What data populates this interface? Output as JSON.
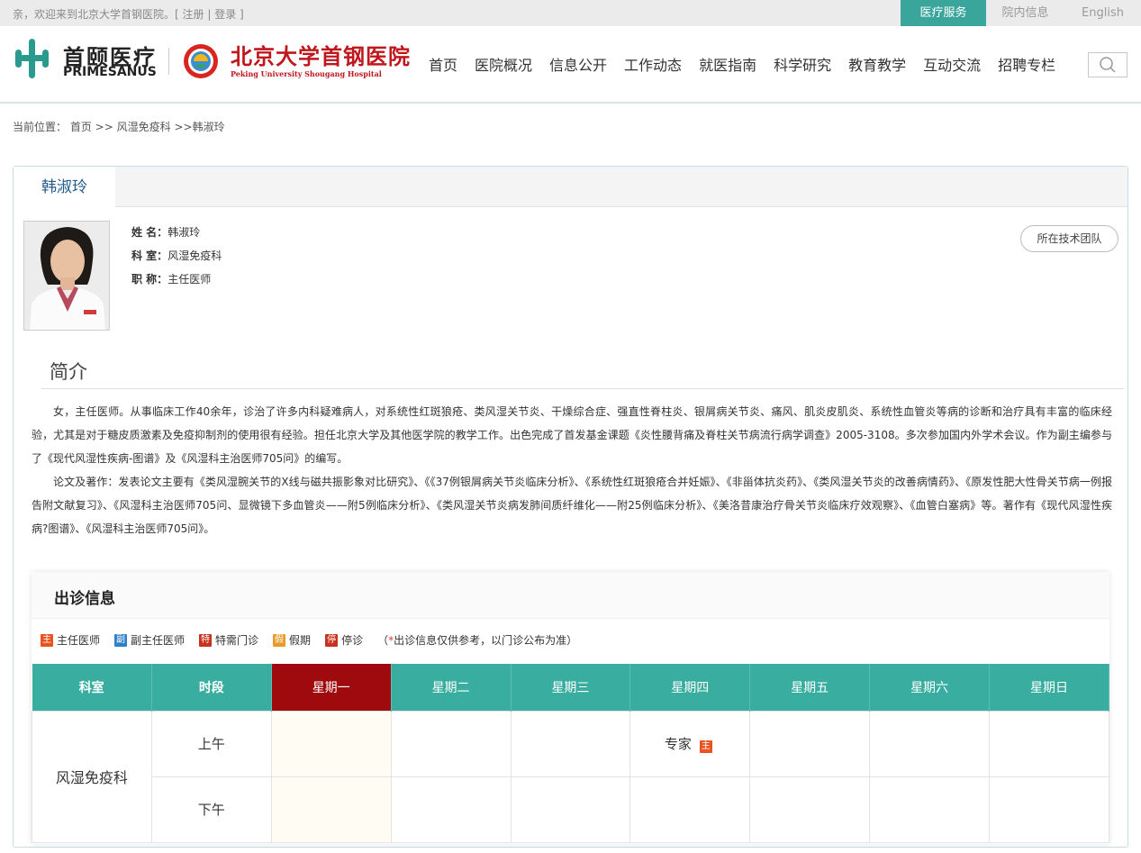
{
  "topbar": {
    "welcome": "亲，欢迎来到北京大学首钢医院。",
    "register": "注册",
    "login": "登录",
    "links": [
      "医疗服务",
      "院内信息",
      "English"
    ]
  },
  "header": {
    "logo1_cn": "首颐医疗",
    "logo1_en": "PRIMESANUS",
    "logo2_cn": "北京大学首钢医院",
    "logo2_en": "Peking University Shougang Hospital",
    "nav": [
      "首页",
      "医院概况",
      "信息公开",
      "工作动态",
      "就医指南",
      "科学研究",
      "教育教学",
      "互动交流",
      "招聘专栏"
    ]
  },
  "breadcrumb": {
    "label": "当前位置：",
    "items": [
      "首页",
      "风湿免疫科",
      "韩淑玲"
    ]
  },
  "doctor": {
    "tab": "韩淑玲",
    "name_label": "姓  名：",
    "name": "韩淑玲",
    "dept_label": "科  室：",
    "dept": "风湿免疫科",
    "title_label": "职  称：",
    "title": "主任医师",
    "team_button": "所在技术团队"
  },
  "intro": {
    "heading": "简介",
    "p1": "女，主任医师。从事临床工作40余年，诊治了许多内科疑难病人，对系统性红斑狼疮、类风湿关节炎、干燥综合症、强直性脊柱炎、银屑病关节炎、痛风、肌炎皮肌炎、系统性血管炎等病的诊断和治疗具有丰富的临床经验，尤其是对于糖皮质激素及免疫抑制剂的使用很有经验。担任北京大学及其他医学院的教学工作。出色完成了首发基金课题《炎性腰背痛及脊柱关节病流行病学调查》2005-3108。多次参加国内外学术会议。作为副主编参与了《现代风湿性疾病-图谱》及《风湿科主治医师705问》的编写。",
    "p2": "论文及著作：发表论文主要有《类风湿腕关节的X线与磁共振影象对比研究》、《《37例银屑病关节炎临床分析》、《系统性红斑狼疮合并妊娠》、《非甾体抗炎药》、《类风湿关节炎的改善病情药》、《原发性肥大性骨关节病一例报告附文献复习》、《风湿科主治医师705问、显微镜下多血管炎——附5例临床分析》、《类风湿关节炎病发肺间质纤维化——附25例临床分析》、《美洛昔康治疗骨关节炎临床疗效观察》、《血管白塞病》等。著作有《现代风湿性疾病?图谱》、《风湿科主治医师705问》。"
  },
  "schedule": {
    "title": "出诊信息",
    "legend": [
      {
        "badge": "主",
        "label": "主任医师",
        "color": "#e8531f"
      },
      {
        "badge": "副",
        "label": "副主任医师",
        "color": "#2f7fc9"
      },
      {
        "badge": "特",
        "label": "特需门诊",
        "color": "#c8321e"
      },
      {
        "badge": "假",
        "label": "假期",
        "color": "#e89a2a"
      },
      {
        "badge": "停",
        "label": "停诊",
        "color": "#c8321e"
      }
    ],
    "note_prefix": "（",
    "note_star": "*",
    "note_text": "出诊信息仅供参考，以门诊公布为准）",
    "headers": [
      "科室",
      "时段",
      "星期一",
      "星期二",
      "星期三",
      "星期四",
      "星期五",
      "星期六",
      "星期日"
    ],
    "dept": "风湿免疫科",
    "periods": [
      "上午",
      "下午"
    ],
    "thu_am": "专家",
    "thu_am_badge": "主"
  }
}
